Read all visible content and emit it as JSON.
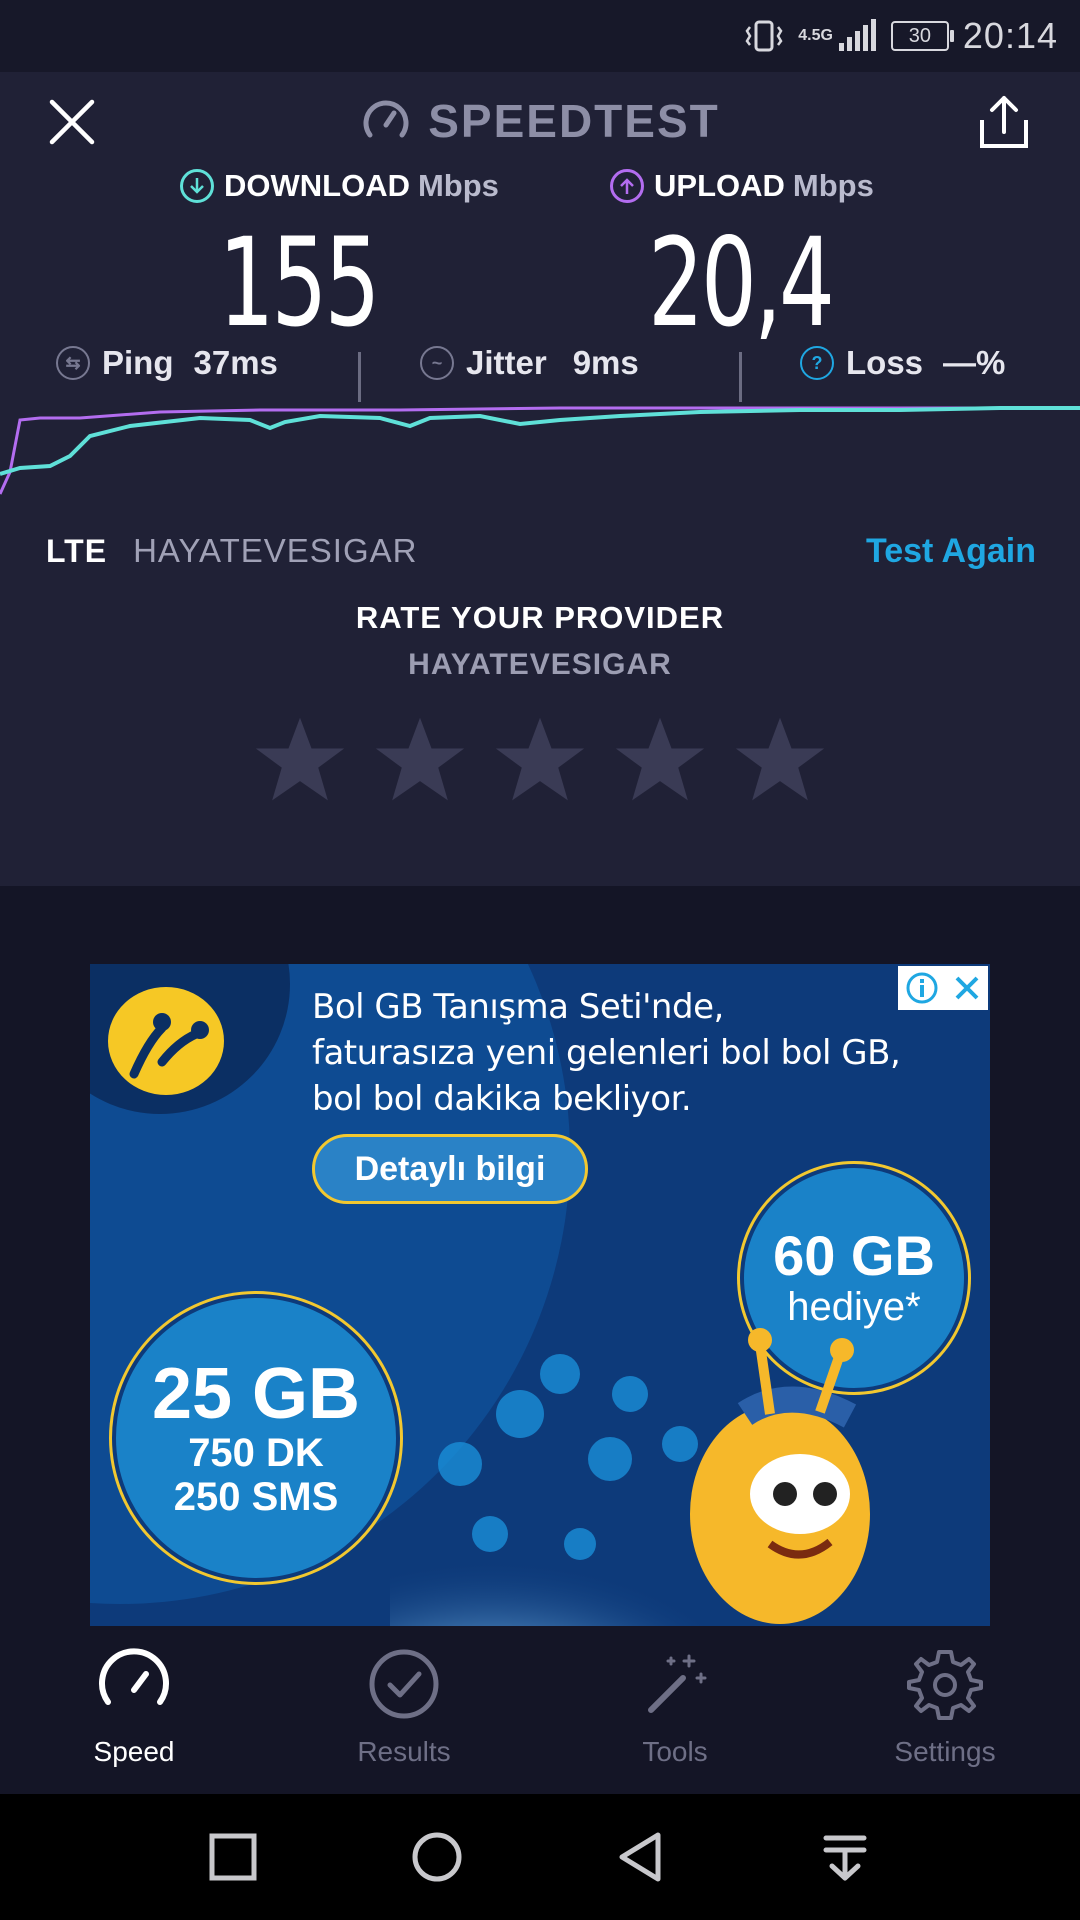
{
  "status_bar": {
    "network": "4.5G",
    "battery": "30",
    "time": "20:14"
  },
  "header": {
    "title": "SPEEDTEST"
  },
  "download": {
    "label": "DOWNLOAD",
    "unit": "Mbps",
    "value": "155"
  },
  "upload": {
    "label": "UPLOAD",
    "unit": "Mbps",
    "value": "20,4"
  },
  "stats": {
    "ping": {
      "label": "Ping",
      "value": "37ms"
    },
    "jitter": {
      "label": "Jitter",
      "value": "9ms"
    },
    "loss": {
      "label": "Loss",
      "value": "—%"
    }
  },
  "provider": {
    "connection": "LTE",
    "name": "HAYATEVESIGAR",
    "test_again": "Test Again"
  },
  "rate": {
    "title": "RATE YOUR PROVIDER",
    "provider": "HAYATEVESIGAR",
    "stars": 0
  },
  "ad": {
    "line1": "Bol GB Tanışma Seti'nde,",
    "line2": "faturasıza yeni gelenleri  bol bol GB,",
    "line3": "bol bol dakika bekliyor.",
    "button": "Detaylı bilgi",
    "badge60_big": "60 GB",
    "badge60_small": "hediye*",
    "badge25_big": "25 GB",
    "badge25_mid": "750 DK",
    "badge25_small": "250 SMS"
  },
  "nav": {
    "speed": "Speed",
    "results": "Results",
    "tools": "Tools",
    "settings": "Settings"
  },
  "colors": {
    "accent_cyan": "#5fe0d8",
    "accent_purple": "#b36df0",
    "link_blue": "#1fa7e2"
  }
}
